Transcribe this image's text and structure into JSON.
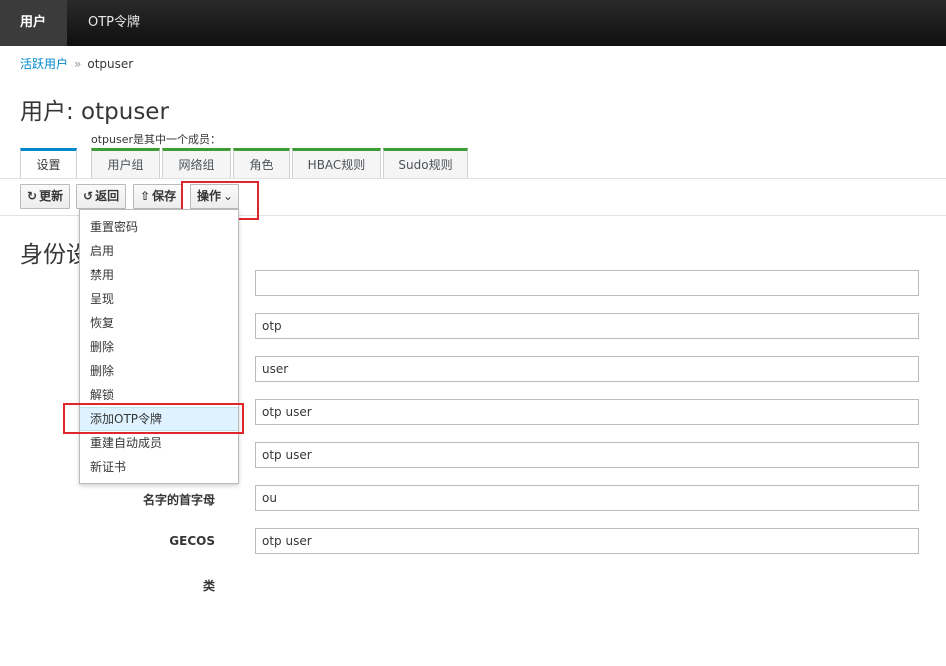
{
  "nav": {
    "users": "用户",
    "otp": "OTP令牌"
  },
  "breadcrumb": {
    "parent": "活跃用户",
    "separator": "»",
    "current": "otpuser"
  },
  "page_title": "用户: otpuser",
  "member_caption": "otpuser是其中一个成员：",
  "tabs": [
    "设置",
    "用户组",
    "网络组",
    "角色",
    "HBAC规则",
    "Sudo规则"
  ],
  "toolbar": {
    "refresh": "更新",
    "refresh_icon": "↻",
    "revert": "返回",
    "revert_icon": "↺",
    "save": "保存",
    "save_icon": "⇧",
    "actions": "操作",
    "actions_icon": "⌄"
  },
  "section_title": "身份设",
  "fields": [
    {
      "label": "",
      "value": ""
    },
    {
      "label": "",
      "value": "otp"
    },
    {
      "label": "",
      "value": "user"
    },
    {
      "label": "",
      "value": "otp user"
    },
    {
      "label": "",
      "value": "otp user"
    },
    {
      "label": "名字的首字母",
      "value": "ou"
    },
    {
      "label": "GECOS",
      "value": "otp user"
    },
    {
      "label": "类",
      "value": ""
    }
  ],
  "actions_menu": [
    "重置密码",
    "启用",
    "禁用",
    "呈现",
    "恢复",
    "删除",
    "删除",
    "解锁",
    "添加OTP令牌",
    "重建自动成员",
    "新证书"
  ],
  "colors": {
    "accent": "#0088ce",
    "member_tab": "#3f9c35",
    "highlight": "#e0262d",
    "hover": "#def3ff"
  }
}
